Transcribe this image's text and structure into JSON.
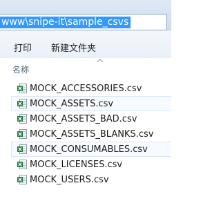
{
  "address": {
    "path": "www\\snipe-it\\sample_csvs"
  },
  "toolbar": {
    "print_label": "打印",
    "new_folder_label": "新建文件夹"
  },
  "columns": {
    "name_label": "名称"
  },
  "files": [
    {
      "name": "MOCK_ACCESSORIES.csv",
      "highlighted": false
    },
    {
      "name": "MOCK_ASSETS.csv",
      "highlighted": true
    },
    {
      "name": "MOCK_ASSETS_BAD.csv",
      "highlighted": false
    },
    {
      "name": "MOCK_ASSETS_BLANKS.csv",
      "highlighted": false
    },
    {
      "name": "MOCK_CONSUMABLES.csv",
      "highlighted": true
    },
    {
      "name": "MOCK_LICENSES.csv",
      "highlighted": false
    },
    {
      "name": "MOCK_USERS.csv",
      "highlighted": false
    }
  ],
  "colors": {
    "selection": "#3399ff",
    "excel_green": "#1f7a3e"
  }
}
